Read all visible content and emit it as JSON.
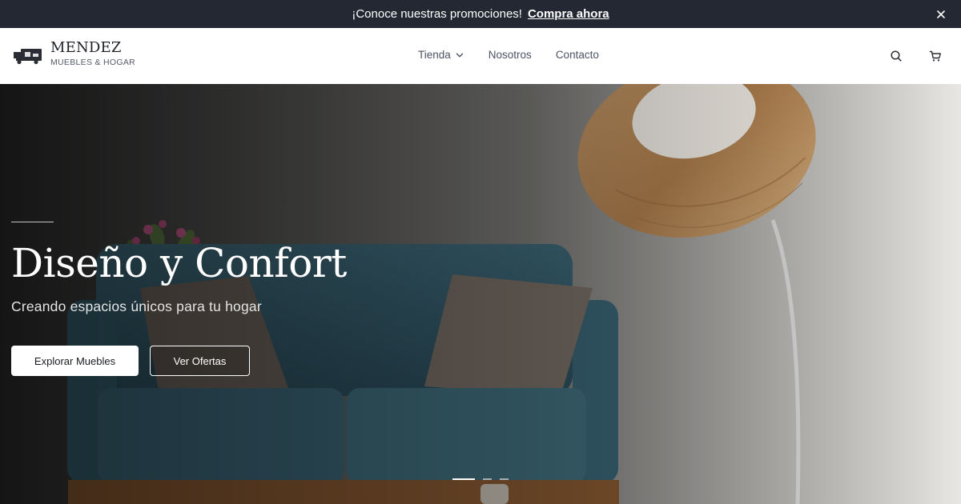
{
  "promo": {
    "message": "¡Conoce nuestras promociones!",
    "cta": "Compra ahora",
    "close_icon": "close-icon"
  },
  "header": {
    "logo": {
      "name": "MENDEZ",
      "tagline": "MUEBLES & HOGAR",
      "icon": "furniture-truck-icon"
    },
    "nav": [
      {
        "label": "Tienda",
        "has_dropdown": true
      },
      {
        "label": "Nosotros",
        "has_dropdown": false
      },
      {
        "label": "Contacto",
        "has_dropdown": false
      }
    ],
    "icons": [
      "search-icon",
      "cart-icon"
    ]
  },
  "hero": {
    "title": "Diseño y Confort",
    "subtitle": "Creando espacios únicos para tu hogar",
    "buttons": {
      "primary": "Explorar Muebles",
      "secondary": "Ver Ofertas"
    },
    "slides": {
      "count": 3,
      "active_index": 0
    }
  },
  "colors": {
    "promo_bg": "#232833",
    "header_bg": "#ffffff",
    "text_dark": "#1f2229",
    "nav_text": "#4b5362",
    "sofa": "#3f6b7c"
  }
}
